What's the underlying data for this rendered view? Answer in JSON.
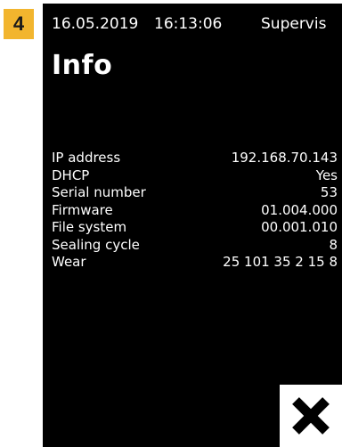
{
  "step": {
    "number": "4"
  },
  "status_bar": {
    "date": "16.05.2019",
    "time": "16:13:06",
    "user": "Supervis"
  },
  "page": {
    "title": "Info"
  },
  "info": [
    {
      "label": "IP address",
      "value": "192.168.70.143"
    },
    {
      "label": "DHCP",
      "value": "Yes"
    },
    {
      "label": "Serial number",
      "value": "53"
    },
    {
      "label": "Firmware",
      "value": "01.004.000"
    },
    {
      "label": "File system",
      "value": "00.001.010"
    },
    {
      "label": "Sealing cycle",
      "value": "8"
    },
    {
      "label": "Wear",
      "value": "25 101 35 2 15 8"
    }
  ],
  "icons": {
    "close": "close-icon"
  },
  "colors": {
    "badge": "#f2b52e",
    "screen_background": "#000000",
    "screen_text": "#ffffff",
    "close_button_background": "#ffffff",
    "close_icon": "#000000"
  }
}
